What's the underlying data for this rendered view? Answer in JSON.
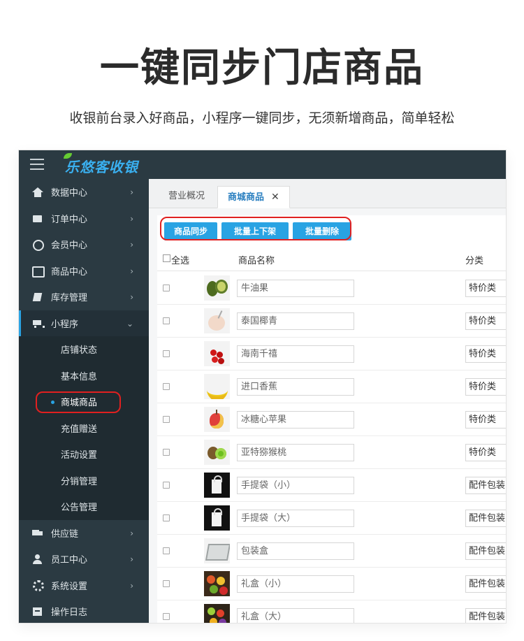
{
  "hero": {
    "title": "一键同步门店商品",
    "subtitle": "收银前台录入好商品，小程序一键同步，无须新增商品，简单轻松"
  },
  "app": {
    "logo_text": "乐悠客收银"
  },
  "sidebar": {
    "items": [
      {
        "label": "数据中心",
        "icon": "home-icon"
      },
      {
        "label": "订单中心",
        "icon": "gift-icon"
      },
      {
        "label": "会员中心",
        "icon": "smile-icon"
      },
      {
        "label": "商品中心",
        "icon": "inbox-icon"
      },
      {
        "label": "库存管理",
        "icon": "book-icon"
      },
      {
        "label": "小程序",
        "icon": "cart-icon"
      }
    ],
    "subitems": [
      "店铺状态",
      "基本信息",
      "商城商品",
      "充值赠送",
      "活动设置",
      "分销管理",
      "公告管理"
    ],
    "bottom_items": [
      {
        "label": "供应链",
        "icon": "truck-icon"
      },
      {
        "label": "员工中心",
        "icon": "user-icon"
      },
      {
        "label": "系统设置",
        "icon": "gear-icon"
      },
      {
        "label": "操作日志",
        "icon": "log-icon"
      }
    ]
  },
  "tabs": {
    "tab1": "营业概况",
    "tab2": "商城商品",
    "close": "✕"
  },
  "toolbar": {
    "sync": "商品同步",
    "batch_shelf": "批量上下架",
    "batch_delete": "批量删除"
  },
  "table": {
    "headers": {
      "select_all": "全选",
      "name": "商品名称",
      "category": "分类"
    },
    "rows": [
      {
        "name": "牛油果",
        "category": "特价类",
        "thumb": "avocado"
      },
      {
        "name": "泰国椰青",
        "category": "特价类",
        "thumb": "coconut"
      },
      {
        "name": "海南千禧",
        "category": "特价类",
        "thumb": "tomato"
      },
      {
        "name": "进口香蕉",
        "category": "特价类",
        "thumb": "banana"
      },
      {
        "name": "冰糖心苹果",
        "category": "特价类",
        "thumb": "apple"
      },
      {
        "name": "亚特猕猴桃",
        "category": "特价类",
        "thumb": "kiwi"
      },
      {
        "name": "手提袋（小）",
        "category": "配件包装",
        "thumb": "bag"
      },
      {
        "name": "手提袋（大）",
        "category": "配件包装",
        "thumb": "bag"
      },
      {
        "name": "包装盒",
        "category": "配件包装",
        "thumb": "tray"
      },
      {
        "name": "礼盒（小）",
        "category": "配件包装",
        "thumb": "gift"
      },
      {
        "name": "礼盒（大）",
        "category": "配件包装",
        "thumb": "gift2"
      }
    ]
  },
  "colors": {
    "sidebar_bg": "#2b3a42",
    "accent": "#29a3e3",
    "highlight_red": "#e02020"
  }
}
